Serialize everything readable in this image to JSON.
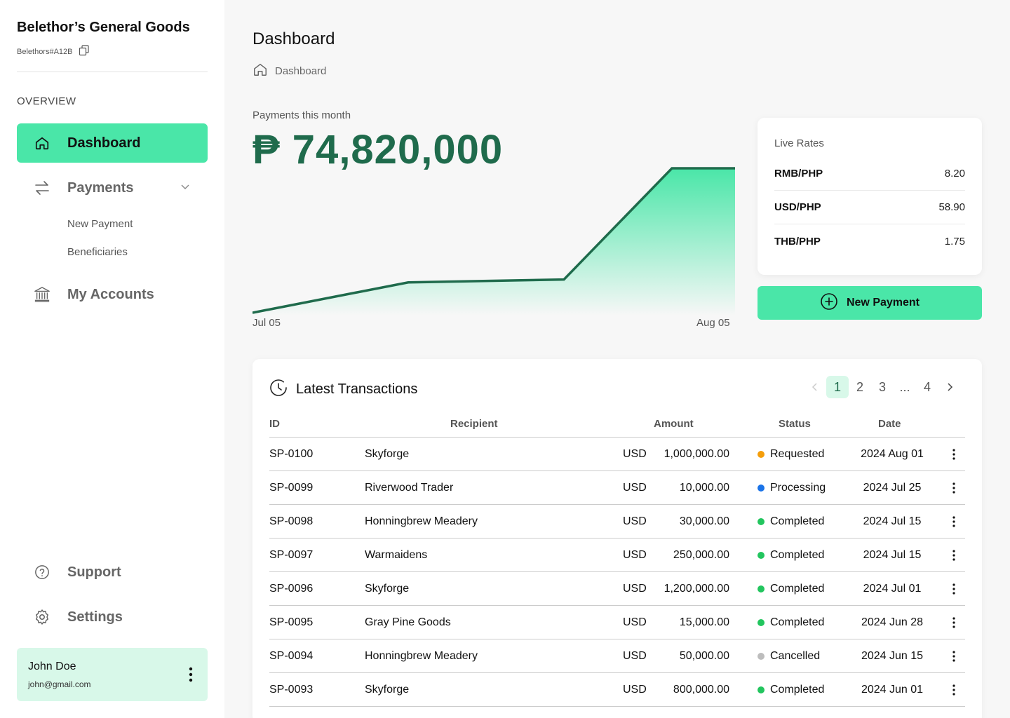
{
  "brand": {
    "name": "Belethor’s General Goods",
    "id": "Belethors#A12B"
  },
  "sidebar": {
    "section_label": "OVERVIEW",
    "items": [
      {
        "label": "Dashboard",
        "icon": "home-icon"
      },
      {
        "label": "Payments",
        "icon": "transfer-arrows-icon"
      },
      {
        "label": "My Accounts",
        "icon": "bank-icon"
      },
      {
        "label": "Support",
        "icon": "help-circle-icon"
      },
      {
        "label": "Settings",
        "icon": "gear-icon"
      }
    ],
    "payments_sub": [
      "New Payment",
      "Beneficiaries"
    ]
  },
  "user": {
    "name": "John Doe",
    "email": "john@gmail.com"
  },
  "page": {
    "title": "Dashboard",
    "breadcrumb": "Dashboard"
  },
  "payments": {
    "label": "Payments this month",
    "amount": "₱ 74,820,000",
    "x_start": "Jul 05",
    "x_end": "Aug 05"
  },
  "chart_data": {
    "type": "area",
    "x": [
      "Jul 05",
      "Jul 15",
      "Jul 25",
      "Aug 01",
      "Aug 05"
    ],
    "values": [
      0,
      0.21,
      0.23,
      1,
      1
    ],
    "xlabel": "",
    "ylabel": "",
    "grid": false,
    "colors": {
      "line": "#1f6b4c",
      "fill": "#4ae6a8"
    }
  },
  "rates": {
    "title": "Live Rates",
    "items": [
      {
        "pair": "RMB/PHP",
        "value": "8.20"
      },
      {
        "pair": "USD/PHP",
        "value": "58.90"
      },
      {
        "pair": "THB/PHP",
        "value": "1.75"
      }
    ]
  },
  "new_payment_label": "New Payment",
  "transactions": {
    "title": "Latest Transactions",
    "pagination": [
      "1",
      "2",
      "3",
      "...",
      "4"
    ],
    "columns": {
      "id": "ID",
      "recipient": "Recipient",
      "amount": "Amount",
      "status": "Status",
      "date": "Date"
    },
    "rows": [
      {
        "id": "SP-0100",
        "recipient": "Skyforge",
        "currency": "USD",
        "amount": "1,000,000.00",
        "status": "Requested",
        "status_color": "#f59e0b",
        "date": "2024 Aug 01"
      },
      {
        "id": "SP-0099",
        "recipient": "Riverwood Trader",
        "currency": "USD",
        "amount": "10,000.00",
        "status": "Processing",
        "status_color": "#1a73e8",
        "date": "2024 Jul 25"
      },
      {
        "id": "SP-0098",
        "recipient": "Honningbrew Meadery",
        "currency": "USD",
        "amount": "30,000.00",
        "status": "Completed",
        "status_color": "#22c55e",
        "date": "2024 Jul 15"
      },
      {
        "id": "SP-0097",
        "recipient": "Warmaidens",
        "currency": "USD",
        "amount": "250,000.00",
        "status": "Completed",
        "status_color": "#22c55e",
        "date": "2024 Jul 15"
      },
      {
        "id": "SP-0096",
        "recipient": "Skyforge",
        "currency": "USD",
        "amount": "1,200,000.00",
        "status": "Completed",
        "status_color": "#22c55e",
        "date": "2024 Jul 01"
      },
      {
        "id": "SP-0095",
        "recipient": "Gray Pine Goods",
        "currency": "USD",
        "amount": "15,000.00",
        "status": "Completed",
        "status_color": "#22c55e",
        "date": "2024 Jun 28"
      },
      {
        "id": "SP-0094",
        "recipient": "Honningbrew Meadery",
        "currency": "USD",
        "amount": "50,000.00",
        "status": "Cancelled",
        "status_color": "#bdbdbd",
        "date": "2024 Jun 15"
      },
      {
        "id": "SP-0093",
        "recipient": "Skyforge",
        "currency": "USD",
        "amount": "800,000.00",
        "status": "Completed",
        "status_color": "#22c55e",
        "date": "2024 Jun 01"
      }
    ]
  }
}
